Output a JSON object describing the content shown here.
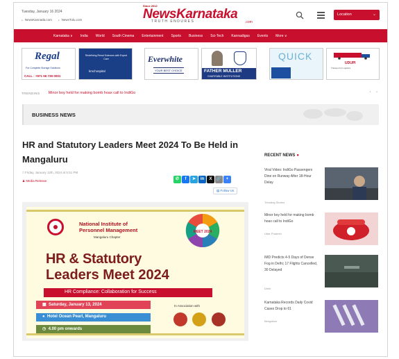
{
  "header": {
    "date": "Tuesday, January 16 2024",
    "top_links": [
      "NewsKannada.com",
      "NewsTulu.com"
    ],
    "logo_tagline": "Since 2012",
    "logo_text": "NewsKarnataka",
    "logo_sub": "TRUTH ENDURES",
    "logo_domain": ".com",
    "location_label": "Location",
    "brand_color": "#c8102e"
  },
  "nav": {
    "items": [
      "Karnataka ∨",
      "India",
      "World",
      "South Cinema",
      "Entertainment",
      "Sports",
      "Business",
      "Sci-Tech",
      "Kannadigas",
      "Events",
      "More ∨"
    ]
  },
  "ads": {
    "regal": {
      "title": "Regal",
      "line1": "For Complete Storage Solutions",
      "phone": "CALL : +971 56 739 0001"
    },
    "kmc": {
      "line1": "Redefining Renal Sciences with Expert Care",
      "brand": "kmchospital"
    },
    "everwhite": {
      "title": "Everwhite",
      "tagline": "YOUR BEST CHOICE"
    },
    "father_muller": {
      "title": "FATHER MULLER",
      "sub": "CHARITABLE INSTITUTIONS"
    },
    "quick": {
      "title": "QUICK"
    },
    "udupi": {
      "title": "UDUPI",
      "line1": "Transport & Logistics"
    }
  },
  "trending": {
    "label": "TRENDING",
    "headline": "Minor boy held for making bomb hoax call to IndiGo",
    "nav": "‹ ›"
  },
  "section": {
    "label": "BUSINESS NEWS"
  },
  "article": {
    "title": "HR and Statutory Leaders Meet 2024 To Be Held in Mangaluru",
    "date": "Friday, January 12th, 2024 at 5:51 PM",
    "author": "Media Release",
    "follow": "Follow Us",
    "share_icons": [
      "whatsapp-icon",
      "facebook-icon",
      "telegram-icon",
      "linkedin-icon",
      "x-icon",
      "copy-link-icon",
      "more-share-icon"
    ]
  },
  "poster": {
    "org_line1": "National Institute of",
    "org_line2": "Personnel Management",
    "org_chapter": "Mangaluru Chapter",
    "headline1": "HR & Statutory",
    "headline2": "Leaders Meet",
    "year": "2024",
    "tagline": "HR Compliance: Collaboration for Success",
    "date": "Saturday, January 13, 2024",
    "venue": "Hotel Ocean Pearl, Mangaluru",
    "time": "4.00 pm onwards",
    "association": "In Association with",
    "wheel_label": "MEET 2024"
  },
  "sidebar": {
    "heading": "RECENT NEWS",
    "items": [
      {
        "title": "Viral Video: IndiGo Passengers Dine on Runway After 18-Hour Delay",
        "category": "Trending Stories"
      },
      {
        "title": "Minor boy held for making bomb hoax call to IndiGo",
        "category": "Uttar Pradesh"
      },
      {
        "title": "IMD Predicts 4-5 Days of Dense Fog in Delhi; 17 Flights Cancelled, 30 Delayed",
        "category": "Delhi"
      },
      {
        "title": "Karnataka Records Daily Covid Cases Drop to 61",
        "category": "Bengaluru"
      }
    ]
  }
}
